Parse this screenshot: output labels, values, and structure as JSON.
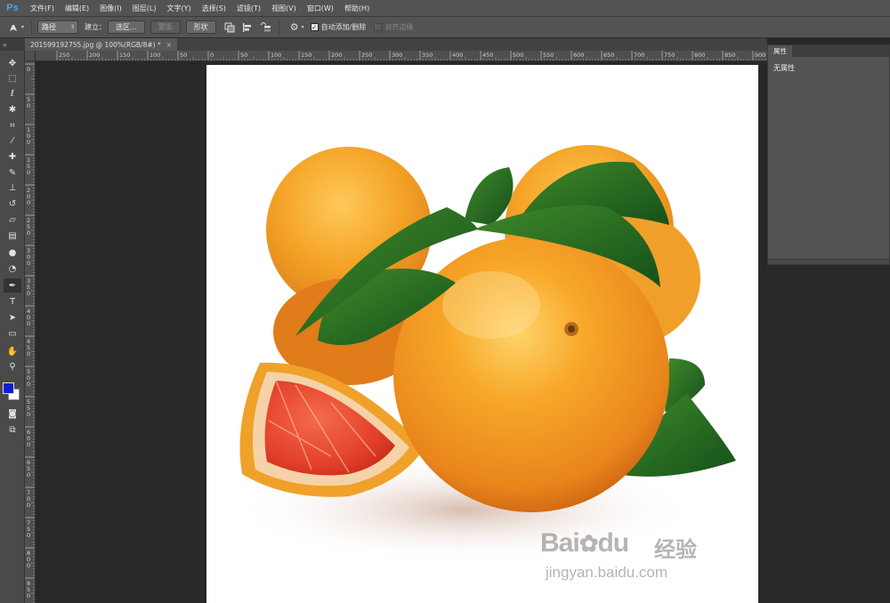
{
  "app": {
    "logo": "Ps",
    "menu": [
      "文件(F)",
      "编辑(E)",
      "图像(I)",
      "图层(L)",
      "文字(Y)",
      "选择(S)",
      "滤镜(T)",
      "视图(V)",
      "窗口(W)",
      "帮助(H)"
    ]
  },
  "options_bar": {
    "tool_icon": "pen-icon",
    "mode_value": "路径",
    "make_label": "建立：",
    "selection_button": "选区...",
    "mask_button": "蒙版",
    "shape_button": "形状",
    "gear_icon": "gear-icon",
    "auto_add_delete_label": "自动添加/删除",
    "auto_add_delete_checked": true,
    "align_edges_label": "对齐边缘",
    "align_edges_checked": false
  },
  "document": {
    "tab_title": "201599192755.jpg @ 100%(RGB/8#) *",
    "close_glyph": "×"
  },
  "rulers": {
    "horizontal": [
      "250",
      "200",
      "150",
      "100",
      "50",
      "0",
      "50",
      "100",
      "150",
      "200",
      "250",
      "300",
      "350",
      "400",
      "450",
      "500",
      "550",
      "600",
      "650",
      "700",
      "750",
      "800",
      "850",
      "900"
    ],
    "vertical": [
      "0",
      "5 0",
      "1 0 0",
      "1 5 0",
      "2 0 0",
      "2 5 0",
      "3 0 0",
      "3 5 0",
      "4 0 0",
      "4 5 0",
      "5 0 0",
      "5 5 0",
      "6 0 0",
      "6 5 0",
      "7 0 0",
      "7 5 0",
      "8 0 0",
      "8 5 0"
    ]
  },
  "tools": [
    {
      "name": "move-tool",
      "glyph": "✥"
    },
    {
      "name": "marquee-tool",
      "glyph": "⬚"
    },
    {
      "name": "lasso-tool",
      "glyph": "ℓ"
    },
    {
      "name": "quick-select-tool",
      "glyph": "✱"
    },
    {
      "name": "crop-tool",
      "glyph": "⌗"
    },
    {
      "name": "eyedropper-tool",
      "glyph": "⁄"
    },
    {
      "name": "healing-brush-tool",
      "glyph": "✚"
    },
    {
      "name": "brush-tool",
      "glyph": "✎"
    },
    {
      "name": "clone-stamp-tool",
      "glyph": "⊥"
    },
    {
      "name": "history-brush-tool",
      "glyph": "↺"
    },
    {
      "name": "eraser-tool",
      "glyph": "▱"
    },
    {
      "name": "gradient-tool",
      "glyph": "▤"
    },
    {
      "name": "blur-tool",
      "glyph": "●"
    },
    {
      "name": "dodge-tool",
      "glyph": "◔"
    },
    {
      "name": "pen-tool",
      "glyph": "✒"
    },
    {
      "name": "type-tool",
      "glyph": "T"
    },
    {
      "name": "path-select-tool",
      "glyph": "➤"
    },
    {
      "name": "rectangle-tool",
      "glyph": "▭"
    },
    {
      "name": "hand-tool",
      "glyph": "✋"
    },
    {
      "name": "zoom-tool",
      "glyph": "⚲"
    }
  ],
  "colors": {
    "foreground": "#0b1fd2",
    "background": "#ffffff"
  },
  "properties_panel": {
    "tab_title": "属性",
    "empty_text": "无属性"
  },
  "watermark": {
    "brand": "Bai",
    "brand2": "du",
    "cn": "经验",
    "url": "jingyan.baidu.com"
  }
}
